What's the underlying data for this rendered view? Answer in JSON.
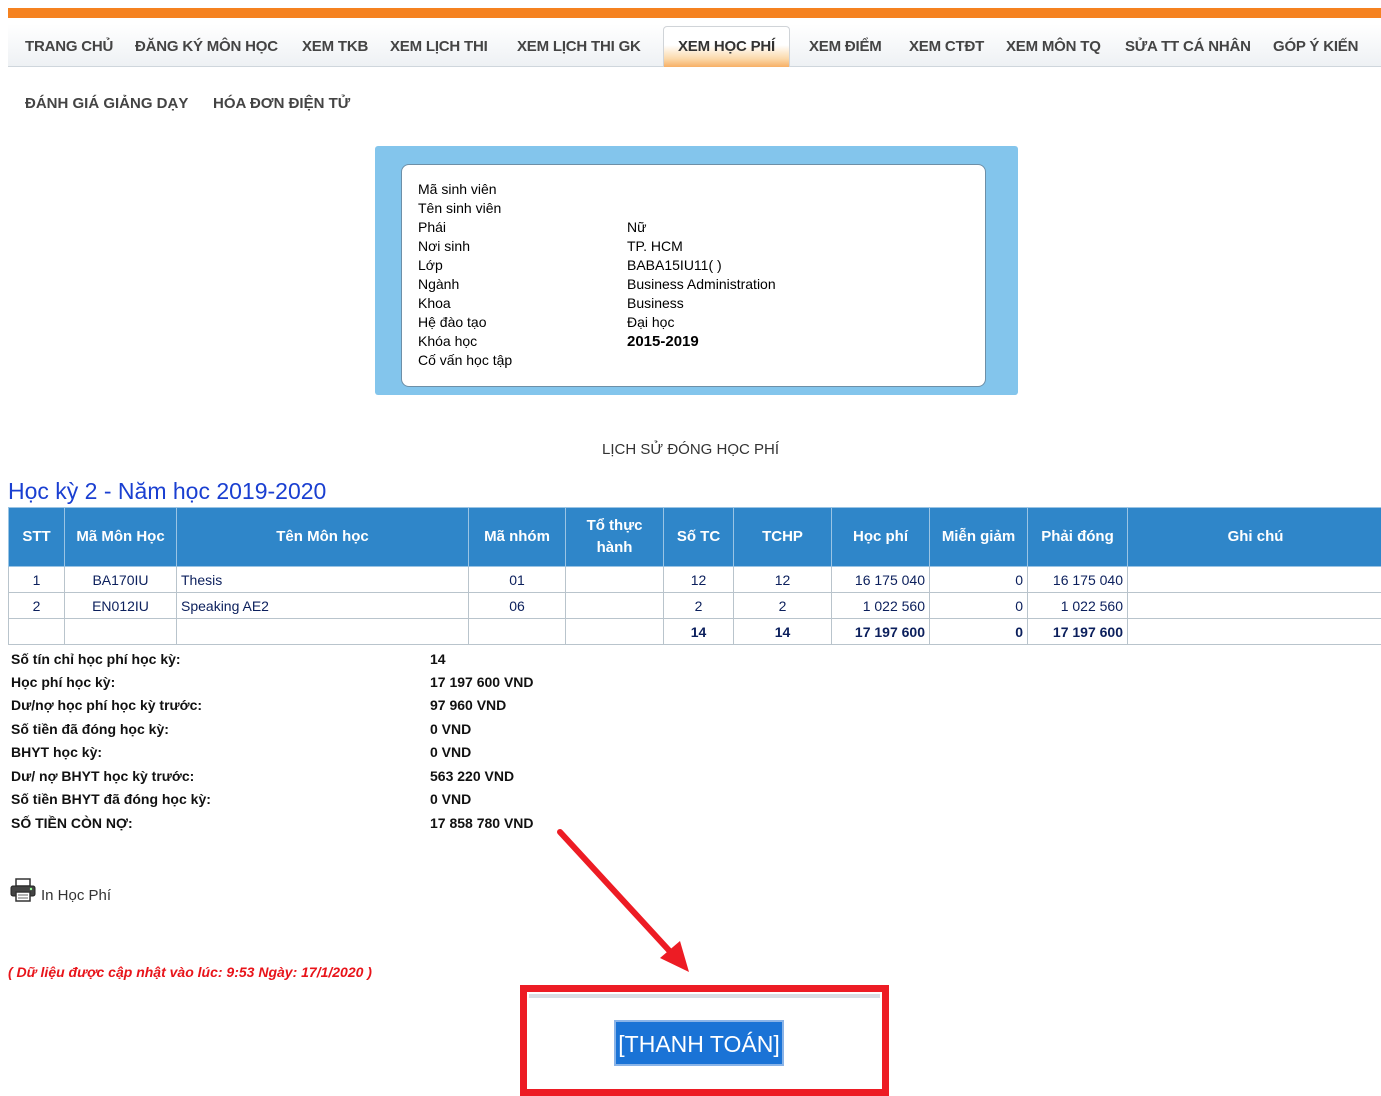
{
  "nav": {
    "items": [
      "TRANG CHỦ",
      "ĐĂNG KÝ MÔN HỌC",
      "XEM TKB",
      "XEM LỊCH THI",
      "XEM LỊCH THI GK",
      "XEM HỌC PHÍ",
      "XEM ĐIỂM",
      "XEM CTĐT",
      "XEM MÔN TQ",
      "SỬA TT CÁ NHÂN",
      "GÓP Ý KIẾN"
    ],
    "active": "XEM HỌC PHÍ",
    "items_row2": [
      "ĐÁNH GIÁ GIẢNG DẠY",
      "HÓA ĐƠN ĐIỆN TỬ"
    ]
  },
  "student": {
    "rows": [
      {
        "label": "Mã sinh viên",
        "value": ""
      },
      {
        "label": "Tên sinh viên",
        "value": ""
      },
      {
        "label": "Phái",
        "value": "Nữ"
      },
      {
        "label": "Nơi sinh",
        "value": "TP. HCM"
      },
      {
        "label": "Lớp",
        "value": "BABA15IU11( )"
      },
      {
        "label": "Ngành",
        "value": "Business Administration"
      },
      {
        "label": "Khoa",
        "value": "Business"
      },
      {
        "label": "Hệ đào tạo",
        "value": "Đại học"
      },
      {
        "label": "Khóa học",
        "value": "2015-2019"
      },
      {
        "label": "Cố vấn học tập",
        "value": ""
      }
    ]
  },
  "history_title": "LỊCH SỬ ĐÓNG HỌC PHÍ",
  "semester_title": "Học kỳ 2 - Năm học 2019-2020",
  "table": {
    "headers": [
      "STT",
      "Mã Môn Học",
      "Tên Môn học",
      "Mã nhóm",
      "Tổ thực hành",
      "Số TC",
      "TCHP",
      "Học phí",
      "Miễn giảm",
      "Phải đóng",
      "Ghi chú"
    ],
    "rows": [
      [
        "1",
        "BA170IU",
        "Thesis",
        "01",
        "",
        "12",
        "12",
        "16 175 040",
        "0",
        "16 175 040",
        ""
      ],
      [
        "2",
        "EN012IU",
        "Speaking AE2",
        "06",
        "",
        "2",
        "2",
        "1 022 560",
        "0",
        "1 022 560",
        ""
      ]
    ],
    "total": [
      "",
      "",
      "",
      "",
      "",
      "14",
      "14",
      "17 197 600",
      "0",
      "17 197 600",
      ""
    ]
  },
  "summary": [
    {
      "label": "Số tín chỉ học phí học kỳ:",
      "value": "14"
    },
    {
      "label": "Học phí học kỳ:",
      "value": "17 197 600 VND"
    },
    {
      "label": "Dư/nợ học phí học kỳ trước:",
      "value": "97 960 VND"
    },
    {
      "label": "Số tiền đã đóng học kỳ:",
      "value": "0 VND"
    },
    {
      "label": "BHYT học kỳ:",
      "value": "0 VND"
    },
    {
      "label": "Dư/ nợ BHYT học kỳ trước:",
      "value": "563 220 VND"
    },
    {
      "label": "Số tiền BHYT đã đóng học kỳ:",
      "value": "0 VND"
    },
    {
      "label": "SỐ TIỀN CÒN NỢ:",
      "value": "17 858 780 VND"
    }
  ],
  "print_label": "In Học Phí",
  "updated_text": "( Dữ liệu được cập nhật vào lúc: 9:53 Ngày: 17/1/2020 )",
  "pay_button": "[THANH TOÁN]",
  "colors": {
    "accent_bar": "#f58220",
    "table_header": "#2f86c9",
    "highlight": "#ed1c24",
    "pay_button": "#1a73d6"
  }
}
